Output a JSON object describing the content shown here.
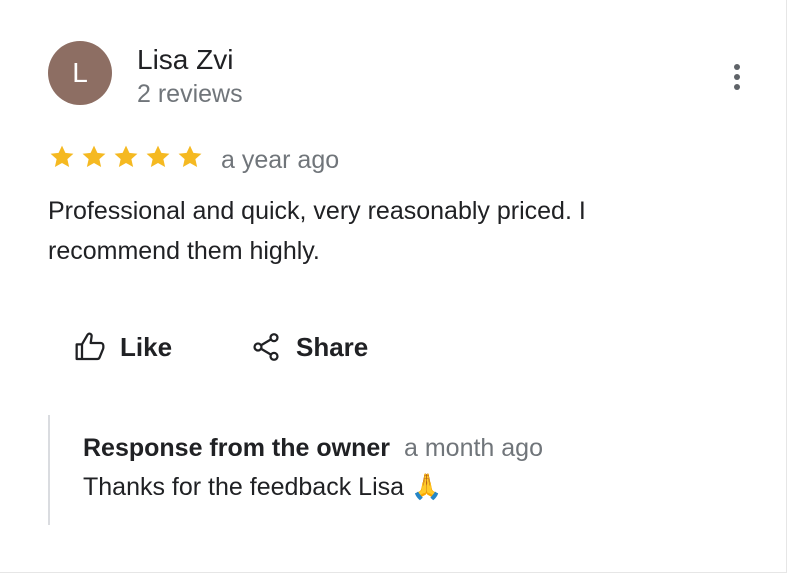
{
  "review": {
    "author": {
      "initial": "L",
      "name": "Lisa Zvi",
      "reviews_count": "2 reviews",
      "avatar_color": "#8d6e63"
    },
    "rating": 5,
    "max_rating": 5,
    "star_color": "#f5b921",
    "time": "a year ago",
    "text": "Professional and quick, very reasonably priced. I recommend them highly.",
    "more_options_icon": "more-vert-icon"
  },
  "actions": {
    "like_label": "Like",
    "like_icon": "thumb-up-icon",
    "share_label": "Share",
    "share_icon": "share-icon"
  },
  "owner_response": {
    "heading": "Response from the owner",
    "time": "a month ago",
    "text": "Thanks for the feedback Lisa 🙏"
  }
}
